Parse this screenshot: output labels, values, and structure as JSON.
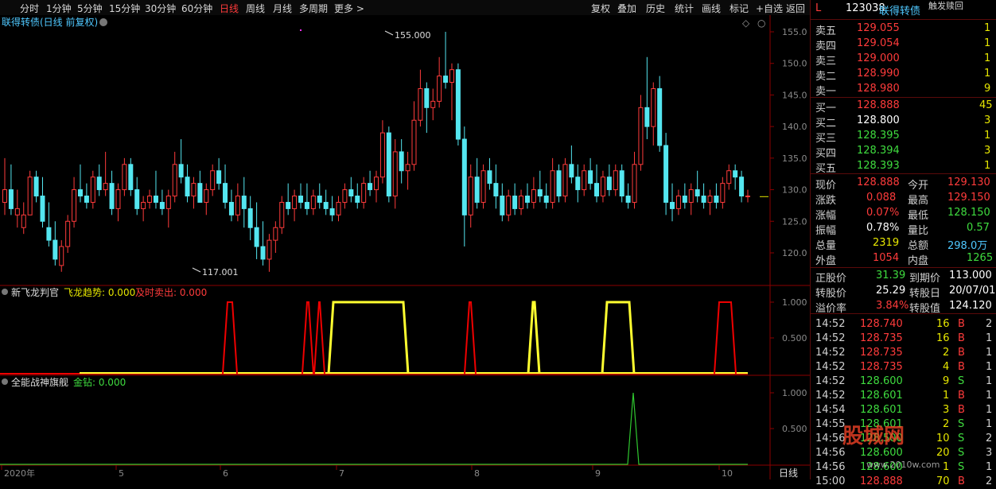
{
  "toolbar": {
    "tabs": [
      "分时",
      "1分钟",
      "5分钟",
      "15分钟",
      "30分钟",
      "60分钟",
      "日线",
      "周线",
      "月线",
      "多周期",
      "更多 >"
    ],
    "active_tab": "日线",
    "right_tools": [
      "复权",
      "叠加",
      "历史",
      "统计",
      "画线",
      "标记",
      "+自选",
      "返回"
    ]
  },
  "main_chart": {
    "title": "联得转债(日线 前复权)",
    "high_label": "155.000",
    "low_label": "117.001",
    "price_ticks": [
      "155.0",
      "150.0",
      "145.0",
      "140.0",
      "135.0",
      "130.0",
      "125.0",
      "120.0"
    ],
    "x_ticks": [
      "2020年",
      "5",
      "6",
      "7",
      "8",
      "9",
      "10"
    ],
    "period_label": "日线"
  },
  "indicator1": {
    "name": "新飞龙判官",
    "line1_label": "飞龙趋势: 0.000",
    "line2_label": "及时卖出: 0.000",
    "ticks": [
      "1.000",
      "0.500"
    ]
  },
  "indicator2": {
    "name": "全能战神旗舰",
    "line1_label": "金钻: 0.000",
    "ticks": [
      "1.000",
      "0.500"
    ]
  },
  "quote": {
    "flag": "L",
    "code": "123038",
    "name": "联得转债",
    "tag": "触发赎回",
    "asks": [
      {
        "label": "卖五",
        "price": "129.055",
        "vol": "1"
      },
      {
        "label": "卖四",
        "price": "129.054",
        "vol": "1"
      },
      {
        "label": "卖三",
        "price": "129.000",
        "vol": "1"
      },
      {
        "label": "卖二",
        "price": "128.990",
        "vol": "1"
      },
      {
        "label": "卖一",
        "price": "128.980",
        "vol": "9"
      }
    ],
    "bids": [
      {
        "label": "买一",
        "price": "128.888",
        "vol": "45"
      },
      {
        "label": "买二",
        "price": "128.800",
        "vol": "3"
      },
      {
        "label": "买三",
        "price": "128.395",
        "vol": "1"
      },
      {
        "label": "买四",
        "price": "128.394",
        "vol": "3"
      },
      {
        "label": "买五",
        "price": "128.393",
        "vol": "1"
      }
    ],
    "stats": [
      {
        "l1": "现价",
        "v1": "128.888",
        "l2": "今开",
        "v2": "129.130"
      },
      {
        "l1": "涨跌",
        "v1": "0.088",
        "l2": "最高",
        "v2": "129.150"
      },
      {
        "l1": "涨幅",
        "v1": "0.07%",
        "l2": "最低",
        "v2": "128.150"
      },
      {
        "l1": "振幅",
        "v1": "0.78%",
        "l2": "量比",
        "v2": "0.57"
      },
      {
        "l1": "总量",
        "v1": "2319",
        "l2": "总额",
        "v2": "298.0万"
      },
      {
        "l1": "外盘",
        "v1": "1054",
        "l2": "内盘",
        "v2": "1265"
      }
    ],
    "bond": [
      {
        "l1": "正股价",
        "v1": "31.39",
        "l2": "到期价",
        "v2": "113.000"
      },
      {
        "l1": "转股价",
        "v1": "25.29",
        "l2": "转股日",
        "v2": "20/07/01"
      },
      {
        "l1": "溢价率",
        "v1": "3.84%",
        "l2": "转股值",
        "v2": "124.120"
      }
    ],
    "trades": [
      {
        "time": "14:52",
        "price": "128.740",
        "vol": "16",
        "side": "B",
        "n": "2"
      },
      {
        "time": "14:52",
        "price": "128.735",
        "vol": "16",
        "side": "B",
        "n": "1"
      },
      {
        "time": "14:52",
        "price": "128.735",
        "vol": "2",
        "side": "B",
        "n": "1"
      },
      {
        "time": "14:52",
        "price": "128.735",
        "vol": "4",
        "side": "B",
        "n": "1"
      },
      {
        "time": "14:52",
        "price": "128.600",
        "vol": "9",
        "side": "S",
        "n": "1"
      },
      {
        "time": "14:52",
        "price": "128.601",
        "vol": "1",
        "side": "B",
        "n": "1"
      },
      {
        "time": "14:54",
        "price": "128.601",
        "vol": "3",
        "side": "B",
        "n": "1"
      },
      {
        "time": "14:55",
        "price": "128.601",
        "vol": "2",
        "side": "S",
        "n": "1"
      },
      {
        "time": "14:56",
        "price": "128.500",
        "vol": "10",
        "side": "S",
        "n": "2"
      },
      {
        "time": "14:56",
        "price": "128.600",
        "vol": "20",
        "side": "S",
        "n": "3"
      },
      {
        "time": "14:56",
        "price": "128.600",
        "vol": "1",
        "side": "S",
        "n": "1"
      },
      {
        "time": "15:00",
        "price": "128.888",
        "vol": "70",
        "side": "B",
        "n": "2"
      }
    ],
    "watermark": "股城网 www.2010w.com"
  },
  "colors": {
    "up": "#ff3b3b",
    "down": "#54e6f0",
    "yellow": "#ffff30",
    "border": "#8b0000",
    "grid_text": "#8a8a8a"
  },
  "chart_data": {
    "type": "candlestick",
    "ylim": [
      115,
      157
    ],
    "ohlc": [
      [
        128,
        135,
        126,
        130
      ],
      [
        130,
        134,
        126,
        127
      ],
      [
        126,
        130,
        124,
        127
      ],
      [
        124,
        128,
        123,
        126
      ],
      [
        126,
        133,
        126,
        132
      ],
      [
        132,
        133,
        128,
        129
      ],
      [
        129,
        132,
        124,
        125
      ],
      [
        124,
        128,
        121,
        122
      ],
      [
        122,
        125,
        118,
        119
      ],
      [
        118,
        122,
        117,
        121
      ],
      [
        121,
        126,
        120,
        125
      ],
      [
        125,
        132,
        124,
        130
      ],
      [
        130,
        134,
        128,
        129
      ],
      [
        129,
        131,
        127,
        128
      ],
      [
        128,
        133,
        127,
        132
      ],
      [
        132,
        134,
        129,
        130
      ],
      [
        130,
        136,
        129,
        131
      ],
      [
        131,
        133,
        126,
        127
      ],
      [
        127,
        131,
        125,
        130
      ],
      [
        130,
        135,
        129,
        134
      ],
      [
        134,
        135,
        129,
        130
      ],
      [
        130,
        132,
        126,
        127
      ],
      [
        127,
        129,
        125,
        128
      ],
      [
        128,
        130,
        127,
        129
      ],
      [
        129,
        133,
        127,
        128
      ],
      [
        128,
        130,
        126,
        127
      ],
      [
        127,
        130,
        124,
        129
      ],
      [
        129,
        136,
        128,
        134
      ],
      [
        134,
        138,
        131,
        132
      ],
      [
        132,
        134,
        128,
        129
      ],
      [
        129,
        132,
        127,
        131
      ],
      [
        131,
        133,
        128,
        128
      ],
      [
        128,
        131,
        126,
        130
      ],
      [
        130,
        134,
        129,
        133
      ],
      [
        133,
        135,
        130,
        131
      ],
      [
        131,
        134,
        127,
        128
      ],
      [
        128,
        130,
        125,
        126
      ],
      [
        126,
        131,
        125,
        129
      ],
      [
        129,
        132,
        124,
        127
      ],
      [
        127,
        129,
        122,
        124
      ],
      [
        124,
        128,
        119,
        121
      ],
      [
        121,
        125,
        118,
        119
      ],
      [
        119,
        123,
        117,
        122
      ],
      [
        122,
        125,
        120,
        124
      ],
      [
        124,
        129,
        123,
        128
      ],
      [
        128,
        131,
        126,
        127
      ],
      [
        127,
        130,
        125,
        129
      ],
      [
        129,
        131,
        127,
        128
      ],
      [
        128,
        131,
        126,
        127
      ],
      [
        127,
        130,
        126,
        129
      ],
      [
        129,
        131,
        127,
        128
      ],
      [
        128,
        130,
        126,
        127
      ],
      [
        127,
        129,
        125,
        126
      ],
      [
        126,
        129,
        125,
        128
      ],
      [
        128,
        131,
        127,
        130
      ],
      [
        130,
        132,
        128,
        129
      ],
      [
        129,
        131,
        127,
        128
      ],
      [
        128,
        132,
        127,
        131
      ],
      [
        131,
        133,
        129,
        130
      ],
      [
        130,
        133,
        128,
        132
      ],
      [
        132,
        141,
        131,
        139
      ],
      [
        139,
        140,
        128,
        129
      ],
      [
        129,
        138,
        127,
        136
      ],
      [
        136,
        138,
        131,
        133
      ],
      [
        133,
        136,
        130,
        134
      ],
      [
        134,
        144,
        133,
        141
      ],
      [
        141,
        149,
        140,
        146
      ],
      [
        146,
        147,
        139,
        143
      ],
      [
        143,
        146,
        141,
        144
      ],
      [
        144,
        151,
        143,
        148
      ],
      [
        148,
        155,
        146,
        147
      ],
      [
        147,
        150,
        141,
        149
      ],
      [
        149,
        150,
        137,
        138
      ],
      [
        138,
        140,
        121,
        126
      ],
      [
        126,
        134,
        124,
        132
      ],
      [
        132,
        135,
        127,
        128
      ],
      [
        128,
        134,
        127,
        133
      ],
      [
        133,
        135,
        130,
        131
      ],
      [
        131,
        134,
        127,
        129
      ],
      [
        129,
        131,
        125,
        126
      ],
      [
        126,
        130,
        125,
        129
      ],
      [
        129,
        131,
        126,
        127
      ],
      [
        127,
        130,
        126,
        129
      ],
      [
        129,
        131,
        127,
        128
      ],
      [
        128,
        132,
        127,
        130
      ],
      [
        130,
        133,
        128,
        129
      ],
      [
        129,
        131,
        127,
        128
      ],
      [
        128,
        135,
        127,
        133
      ],
      [
        133,
        134,
        128,
        129
      ],
      [
        129,
        135,
        128,
        134
      ],
      [
        134,
        137,
        131,
        132
      ],
      [
        132,
        134,
        128,
        130
      ],
      [
        130,
        134,
        129,
        133
      ],
      [
        133,
        135,
        130,
        131
      ],
      [
        131,
        134,
        128,
        129
      ],
      [
        129,
        133,
        128,
        132
      ],
      [
        132,
        134,
        129,
        130
      ],
      [
        130,
        134,
        129,
        133
      ],
      [
        133,
        134,
        128,
        129
      ],
      [
        129,
        131,
        127,
        128
      ],
      [
        128,
        136,
        127,
        134
      ],
      [
        134,
        145,
        133,
        143
      ],
      [
        143,
        151,
        138,
        140
      ],
      [
        140,
        147,
        137,
        146
      ],
      [
        146,
        148,
        136,
        137
      ],
      [
        137,
        139,
        126,
        128
      ],
      [
        128,
        131,
        125,
        127
      ],
      [
        127,
        130,
        126,
        129
      ],
      [
        129,
        131,
        127,
        128
      ],
      [
        128,
        131,
        126,
        130
      ],
      [
        130,
        133,
        128,
        129
      ],
      [
        129,
        131,
        127,
        128
      ],
      [
        128,
        130,
        126,
        129
      ],
      [
        129,
        131,
        127,
        128
      ],
      [
        128,
        132,
        127,
        131
      ],
      [
        131,
        134,
        130,
        133
      ],
      [
        133,
        134,
        130,
        132
      ],
      [
        132,
        133,
        128,
        129
      ],
      [
        129,
        130,
        128,
        129
      ]
    ]
  }
}
